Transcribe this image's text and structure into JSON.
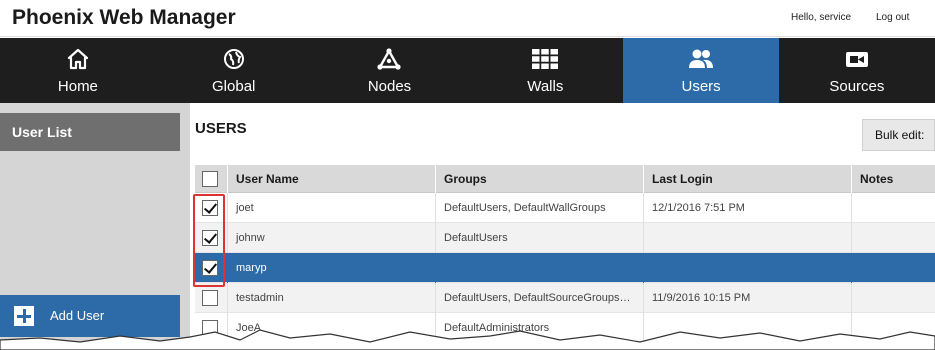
{
  "app": {
    "title": "Phoenix Web Manager"
  },
  "header": {
    "greeting": "Hello, service",
    "logout_label": "Log out"
  },
  "nav": {
    "items": [
      {
        "label": "Home",
        "icon": "home-icon",
        "active": false
      },
      {
        "label": "Global",
        "icon": "globe-icon",
        "active": false
      },
      {
        "label": "Nodes",
        "icon": "nodes-icon",
        "active": false
      },
      {
        "label": "Walls",
        "icon": "grid-icon",
        "active": false
      },
      {
        "label": "Users",
        "icon": "users-icon",
        "active": true
      },
      {
        "label": "Sources",
        "icon": "video-camera-icon",
        "active": false
      }
    ]
  },
  "sidebar": {
    "header": "User List",
    "add_user_label": "Add User"
  },
  "main": {
    "title": "USERS",
    "bulk_edit_label": "Bulk edit:"
  },
  "table": {
    "columns": [
      "User Name",
      "Groups",
      "Last Login",
      "Notes"
    ],
    "rows": [
      {
        "user": "joet",
        "groups": "DefaultUsers, DefaultWallGroups",
        "last_login": "12/1/2016 7:51 PM",
        "notes": "",
        "checked": true,
        "selected": false
      },
      {
        "user": "johnw",
        "groups": "DefaultUsers",
        "last_login": "",
        "notes": "",
        "checked": true,
        "selected": false
      },
      {
        "user": "maryp",
        "groups": "",
        "last_login": "",
        "notes": "",
        "checked": true,
        "selected": true
      },
      {
        "user": "testadmin",
        "groups": "DefaultUsers, DefaultSourceGroups…",
        "last_login": "11/9/2016 10:15 PM",
        "notes": "",
        "checked": false,
        "selected": false
      },
      {
        "user": "JoeA",
        "groups": "DefaultAdministrators",
        "last_login": "",
        "notes": "",
        "checked": false,
        "selected": false
      }
    ]
  },
  "colors": {
    "nav_bg": "#1e1e1e",
    "accent": "#2c6aa8",
    "sidebar_bg": "#d5d5d5",
    "highlight": "#dd3333"
  }
}
